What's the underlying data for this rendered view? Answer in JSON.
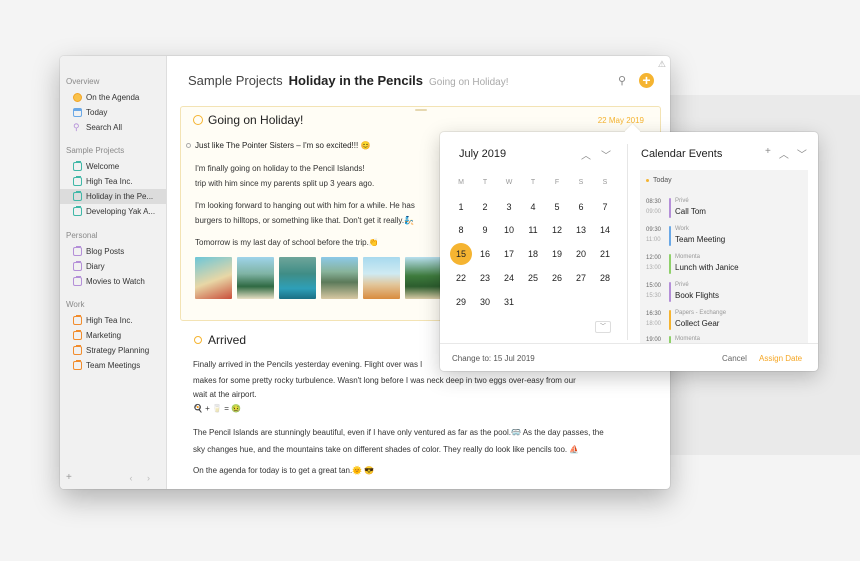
{
  "colors": {
    "accent": "#f5b431",
    "privé": "#b48fd8",
    "work": "#6aa8e6",
    "momenta": "#8fd06a",
    "papers": "#f5b431"
  },
  "sidebar": {
    "sections": [
      {
        "label": "Overview",
        "items": [
          {
            "label": "On the Agenda",
            "icon": "agenda-icon"
          },
          {
            "label": "Today",
            "icon": "calendar-icon"
          },
          {
            "label": "Search All",
            "icon": "search-icon"
          }
        ]
      },
      {
        "label": "Sample Projects",
        "items": [
          {
            "label": "Welcome",
            "icon": "note-icon"
          },
          {
            "label": "High Tea Inc.",
            "icon": "note-icon"
          },
          {
            "label": "Holiday in the Pe...",
            "icon": "note-icon"
          },
          {
            "label": "Developing Yak A...",
            "icon": "note-icon"
          }
        ]
      },
      {
        "label": "Personal",
        "items": [
          {
            "label": "Blog Posts",
            "icon": "note-icon"
          },
          {
            "label": "Diary",
            "icon": "note-icon"
          },
          {
            "label": "Movies to Watch",
            "icon": "note-icon"
          }
        ]
      },
      {
        "label": "Work",
        "items": [
          {
            "label": "High Tea Inc.",
            "icon": "note-icon"
          },
          {
            "label": "Marketing",
            "icon": "note-icon"
          },
          {
            "label": "Strategy Planning",
            "icon": "note-icon"
          },
          {
            "label": "Team Meetings",
            "icon": "note-icon"
          }
        ]
      }
    ],
    "add_label": "+",
    "nav_arrows": "‹ ›"
  },
  "header": {
    "project": "Sample Projects",
    "note": "Holiday in the Pencils",
    "subtitle": "Going on Holiday!",
    "add_label": "+"
  },
  "card": {
    "title": "Going on Holiday!",
    "date": "22 May 2019",
    "task": "Just like The Pointer Sisters – I'm so excited!!! 😊",
    "paragraphs": [
      "I'm finally going on holiday to the Pencil Islands!",
      "trip with him since my parents split up 3 years ago.",
      "I'm looking forward to hanging out with him for a while. He has",
      "burgers to hilltops, or something like that. Don't get it really.🧞",
      "Tomorrow is my last day of school before the trip.👏"
    ]
  },
  "arrived": {
    "title": "Arrived",
    "lines": [
      "Finally arrived in the Pencils yesterday evening. Flight over was l",
      "makes for some pretty rocky turbulence. Wasn't long before I was neck deep in two eggs over-easy from our",
      "wait at the airport.",
      "🍳 + 🥛 = 🤢",
      "The Pencil Islands are stunningly beautiful, even if I have only ventured as far as the pool.🥽 As the day passes, the",
      "sky changes hue, and the mountains take on different shades of color. They really do look like pencils too. ⛵",
      "On the agenda for today is to get a great tan.🌞 😎"
    ]
  },
  "calendar": {
    "month": "July 2019",
    "weekdays": [
      "M",
      "T",
      "W",
      "T",
      "F",
      "S",
      "S"
    ],
    "weeks": [
      [
        "1",
        "2",
        "3",
        "4",
        "5",
        "6",
        "7"
      ],
      [
        "8",
        "9",
        "10",
        "11",
        "12",
        "13",
        "14"
      ],
      [
        "15",
        "16",
        "17",
        "18",
        "19",
        "20",
        "21"
      ],
      [
        "22",
        "23",
        "24",
        "25",
        "26",
        "27",
        "28"
      ],
      [
        "29",
        "30",
        "31",
        "",
        "",
        "",
        ""
      ]
    ],
    "selected": "15",
    "change_to": "Change to: 15 Jul 2019"
  },
  "events": {
    "title": "Calendar Events",
    "today_label": "Today",
    "items": [
      {
        "start": "08:30",
        "end": "09:00",
        "calendar": "Privé",
        "name": "Call Tom",
        "color": "#b48fd8"
      },
      {
        "start": "09:30",
        "end": "11:00",
        "calendar": "Work",
        "name": "Team Meeting",
        "color": "#6aa8e6"
      },
      {
        "start": "12:00",
        "end": "13:00",
        "calendar": "Momenta",
        "name": "Lunch with Janice",
        "color": "#8fd06a"
      },
      {
        "start": "15:00",
        "end": "15:30",
        "calendar": "Privé",
        "name": "Book Flights",
        "color": "#b48fd8"
      },
      {
        "start": "16:30",
        "end": "18:00",
        "calendar": "Papers - Exchange",
        "name": "Collect Gear",
        "color": "#f5b431"
      },
      {
        "start": "19:00",
        "end": "",
        "calendar": "Momenta",
        "name": "",
        "color": "#8fd06a"
      }
    ],
    "cancel_label": "Cancel",
    "assign_label": "Assign Date"
  }
}
